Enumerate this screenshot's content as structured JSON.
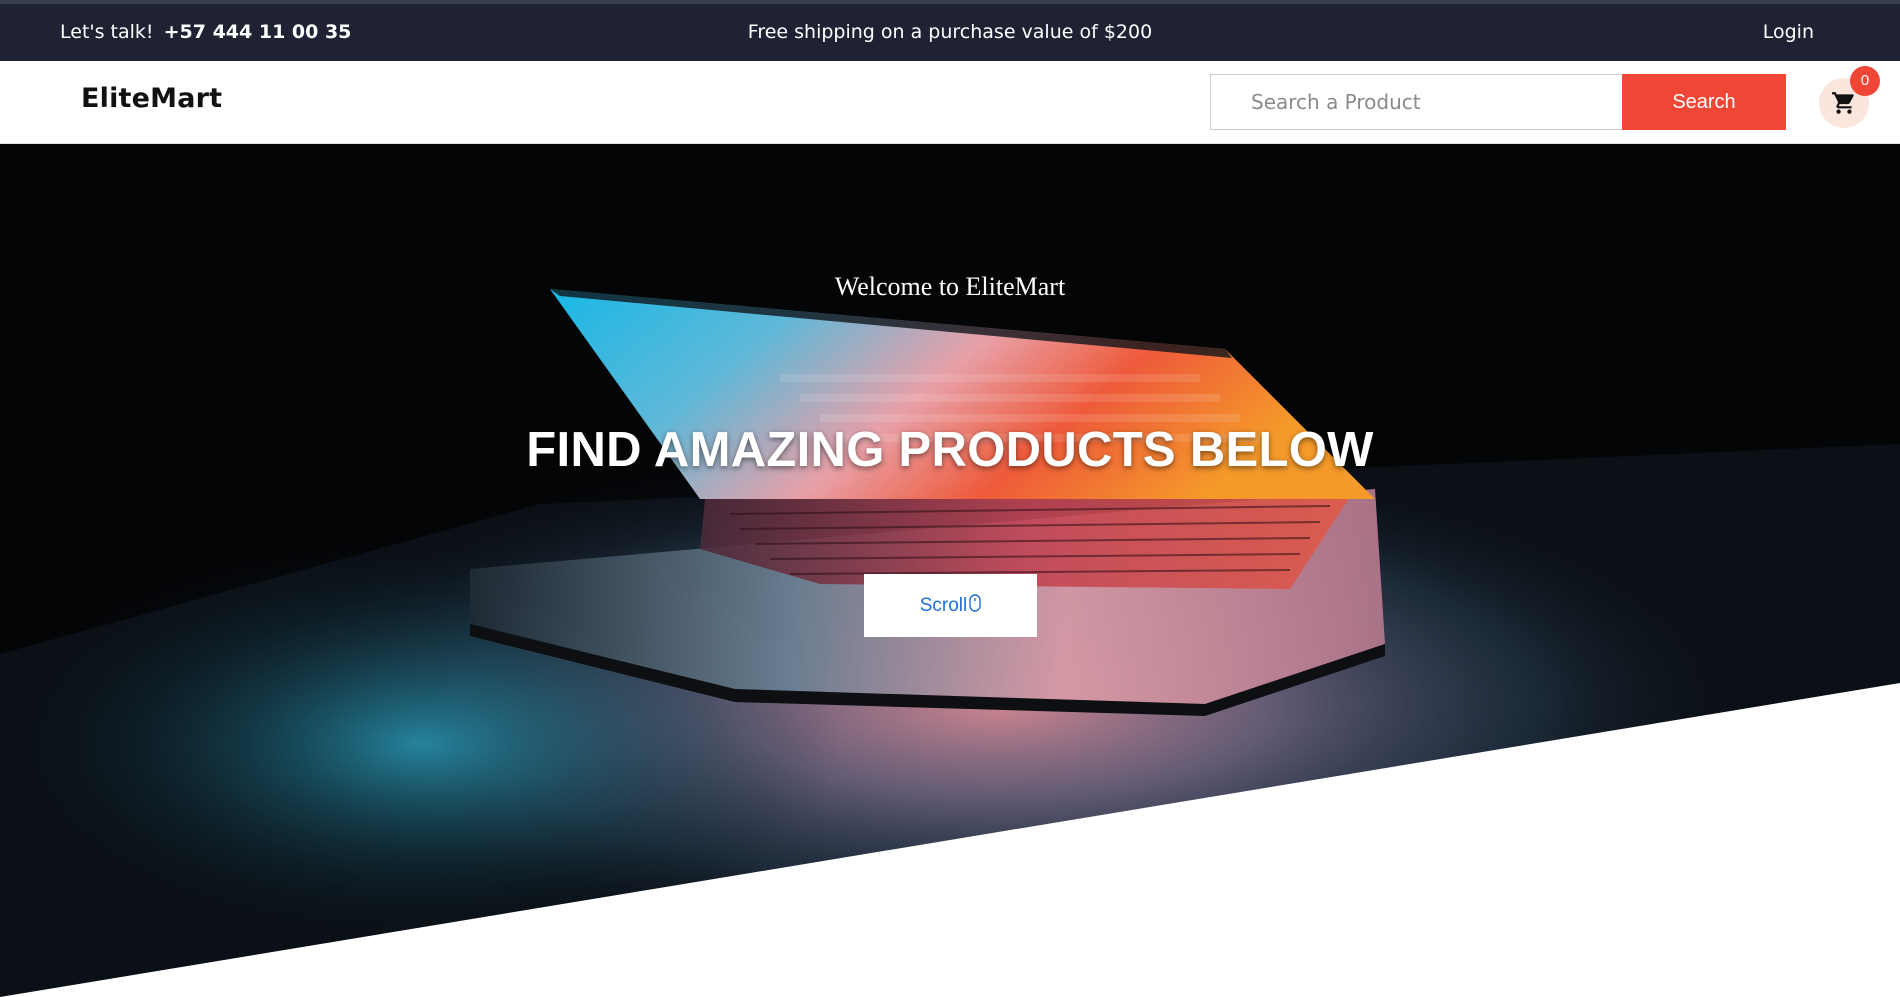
{
  "topbar": {
    "contact_label": "Let's talk!",
    "contact_phone": "+57 444 11 00 35",
    "promo": "Free shipping on a purchase value of $200",
    "login_label": "Login"
  },
  "header": {
    "brand": "EliteMart",
    "search": {
      "placeholder": "Search a Product",
      "value": "",
      "button_label": "Search"
    },
    "cart": {
      "icon": "shopping-cart-icon",
      "count": "0"
    }
  },
  "hero": {
    "welcome": "Welcome to EliteMart",
    "headline": "FIND AMAZING PRODUCTS BELOW",
    "scroll_label": "Scroll",
    "scroll_icon": "mouse-icon"
  },
  "colors": {
    "topbar_bg": "#1e2233",
    "accent": "#ef4636",
    "cart_bg": "#fbe6dd",
    "scroll_text": "#1f6fd6"
  }
}
